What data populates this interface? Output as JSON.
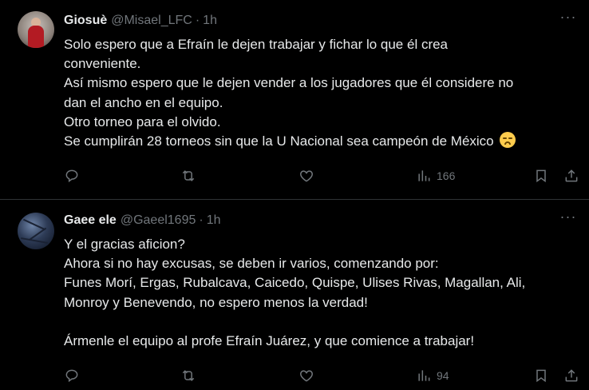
{
  "tweets": [
    {
      "name": "Giosuè",
      "handle": "@Misael_LFC",
      "sep": "·",
      "time": "1h",
      "lines": [
        "Solo espero que a Efraín le dejen trabajar y fichar lo que él crea",
        "conveniente.",
        "Así mismo espero que le dejen vender a los jugadores que él considere no",
        "dan el ancho en el equipo.",
        "Otro torneo para el olvido.",
        "Se cumplirán 28 torneos sin que la U Nacional sea campeón de México"
      ],
      "emoji": "disappointed-face",
      "views": "166"
    },
    {
      "name": "Gaee ele",
      "handle": "@Gaeel1695",
      "sep": "·",
      "time": "1h",
      "lines": [
        "Y el gracias aficion?",
        "Ahora si no hay excusas, se deben ir varios, comenzando por:",
        "Funes Morí, Ergas, Rubalcava, Caicedo, Quispe, Ulises Rivas, Magallan, Ali,",
        "Monroy y Benevendo, no espero menos la verdad!",
        "",
        "Ármenle el equipo al profe Efraín Juárez, y que comience a trabajar!"
      ],
      "views": "94"
    }
  ],
  "more_label": "···",
  "icons": [
    "reply-icon",
    "retweet-icon",
    "like-icon",
    "views-icon",
    "bookmark-icon",
    "share-icon"
  ]
}
